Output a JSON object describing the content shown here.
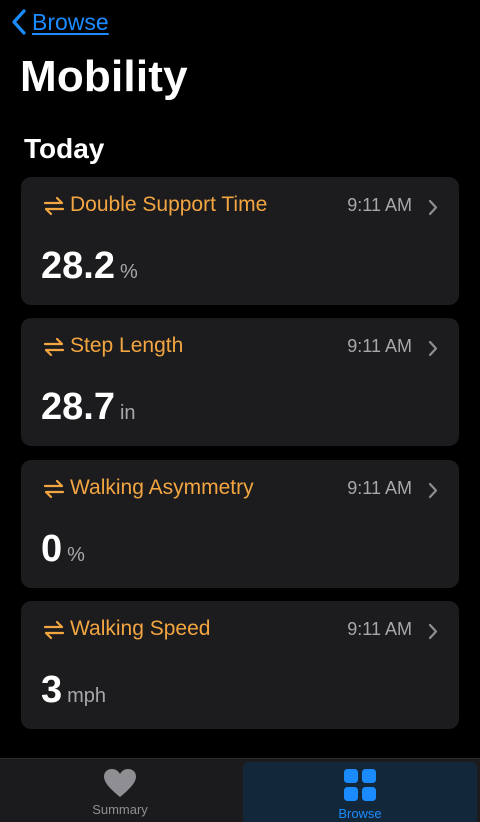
{
  "nav": {
    "back_label": "Browse"
  },
  "page": {
    "title": "Mobility",
    "section": "Today"
  },
  "colors": {
    "accent_blue": "#1a8cff",
    "metric_orange": "#f2a541",
    "card_bg": "#1c1c1e",
    "background": "#000000"
  },
  "metrics": [
    {
      "title": "Double Support Time",
      "time": "9:11 AM",
      "value": "28.2",
      "unit": "%",
      "icon": "arrows-exchange-icon"
    },
    {
      "title": "Step Length",
      "time": "9:11 AM",
      "value": "28.7",
      "unit": "in",
      "icon": "arrows-exchange-icon"
    },
    {
      "title": "Walking Asymmetry",
      "time": "9:11 AM",
      "value": "0",
      "unit": "%",
      "icon": "arrows-exchange-icon"
    },
    {
      "title": "Walking Speed",
      "time": "9:11 AM",
      "value": "3",
      "unit": "mph",
      "icon": "arrows-exchange-icon"
    }
  ],
  "tabbar": {
    "summary_label": "Summary",
    "browse_label": "Browse",
    "selected": "Browse"
  }
}
